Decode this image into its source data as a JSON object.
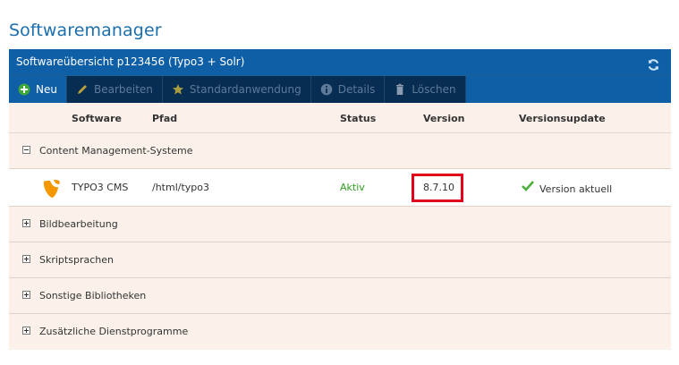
{
  "page": {
    "title": "Softwaremanager"
  },
  "panel": {
    "title": "Softwareübersicht p123456 (Typo3 + Solr)"
  },
  "toolbar": {
    "buttons": [
      {
        "label": "Neu",
        "icon": "plus-circle-icon",
        "active": true
      },
      {
        "label": "Bearbeiten",
        "icon": "pencil-icon",
        "active": false
      },
      {
        "label": "Standardanwendung",
        "icon": "star-icon",
        "active": false
      },
      {
        "label": "Details",
        "icon": "info-icon",
        "active": false
      },
      {
        "label": "Löschen",
        "icon": "trash-icon",
        "active": false
      }
    ]
  },
  "table": {
    "columns": [
      "Software",
      "Pfad",
      "Status",
      "Version",
      "Versionsupdate"
    ],
    "groups": [
      {
        "name": "Content Management-Systeme",
        "expanded": true,
        "rows": [
          {
            "software": "TYPO3 CMS",
            "path": "/html/typo3",
            "status": "Aktiv",
            "version": "8.7.10",
            "update": "Version aktuell"
          }
        ]
      },
      {
        "name": "Bildbearbeitung",
        "expanded": false
      },
      {
        "name": "Skriptsprachen",
        "expanded": false
      },
      {
        "name": "Sonstige Bibliotheken",
        "expanded": false
      },
      {
        "name": "Zusätzliche Dienstprogramme",
        "expanded": false
      }
    ]
  },
  "colors": {
    "accent": "#0e5fa6",
    "toolbar_bg": "#082d52",
    "status_active": "#2e9e1f",
    "highlight_border": "#e0001a",
    "title": "#1b6fae"
  }
}
